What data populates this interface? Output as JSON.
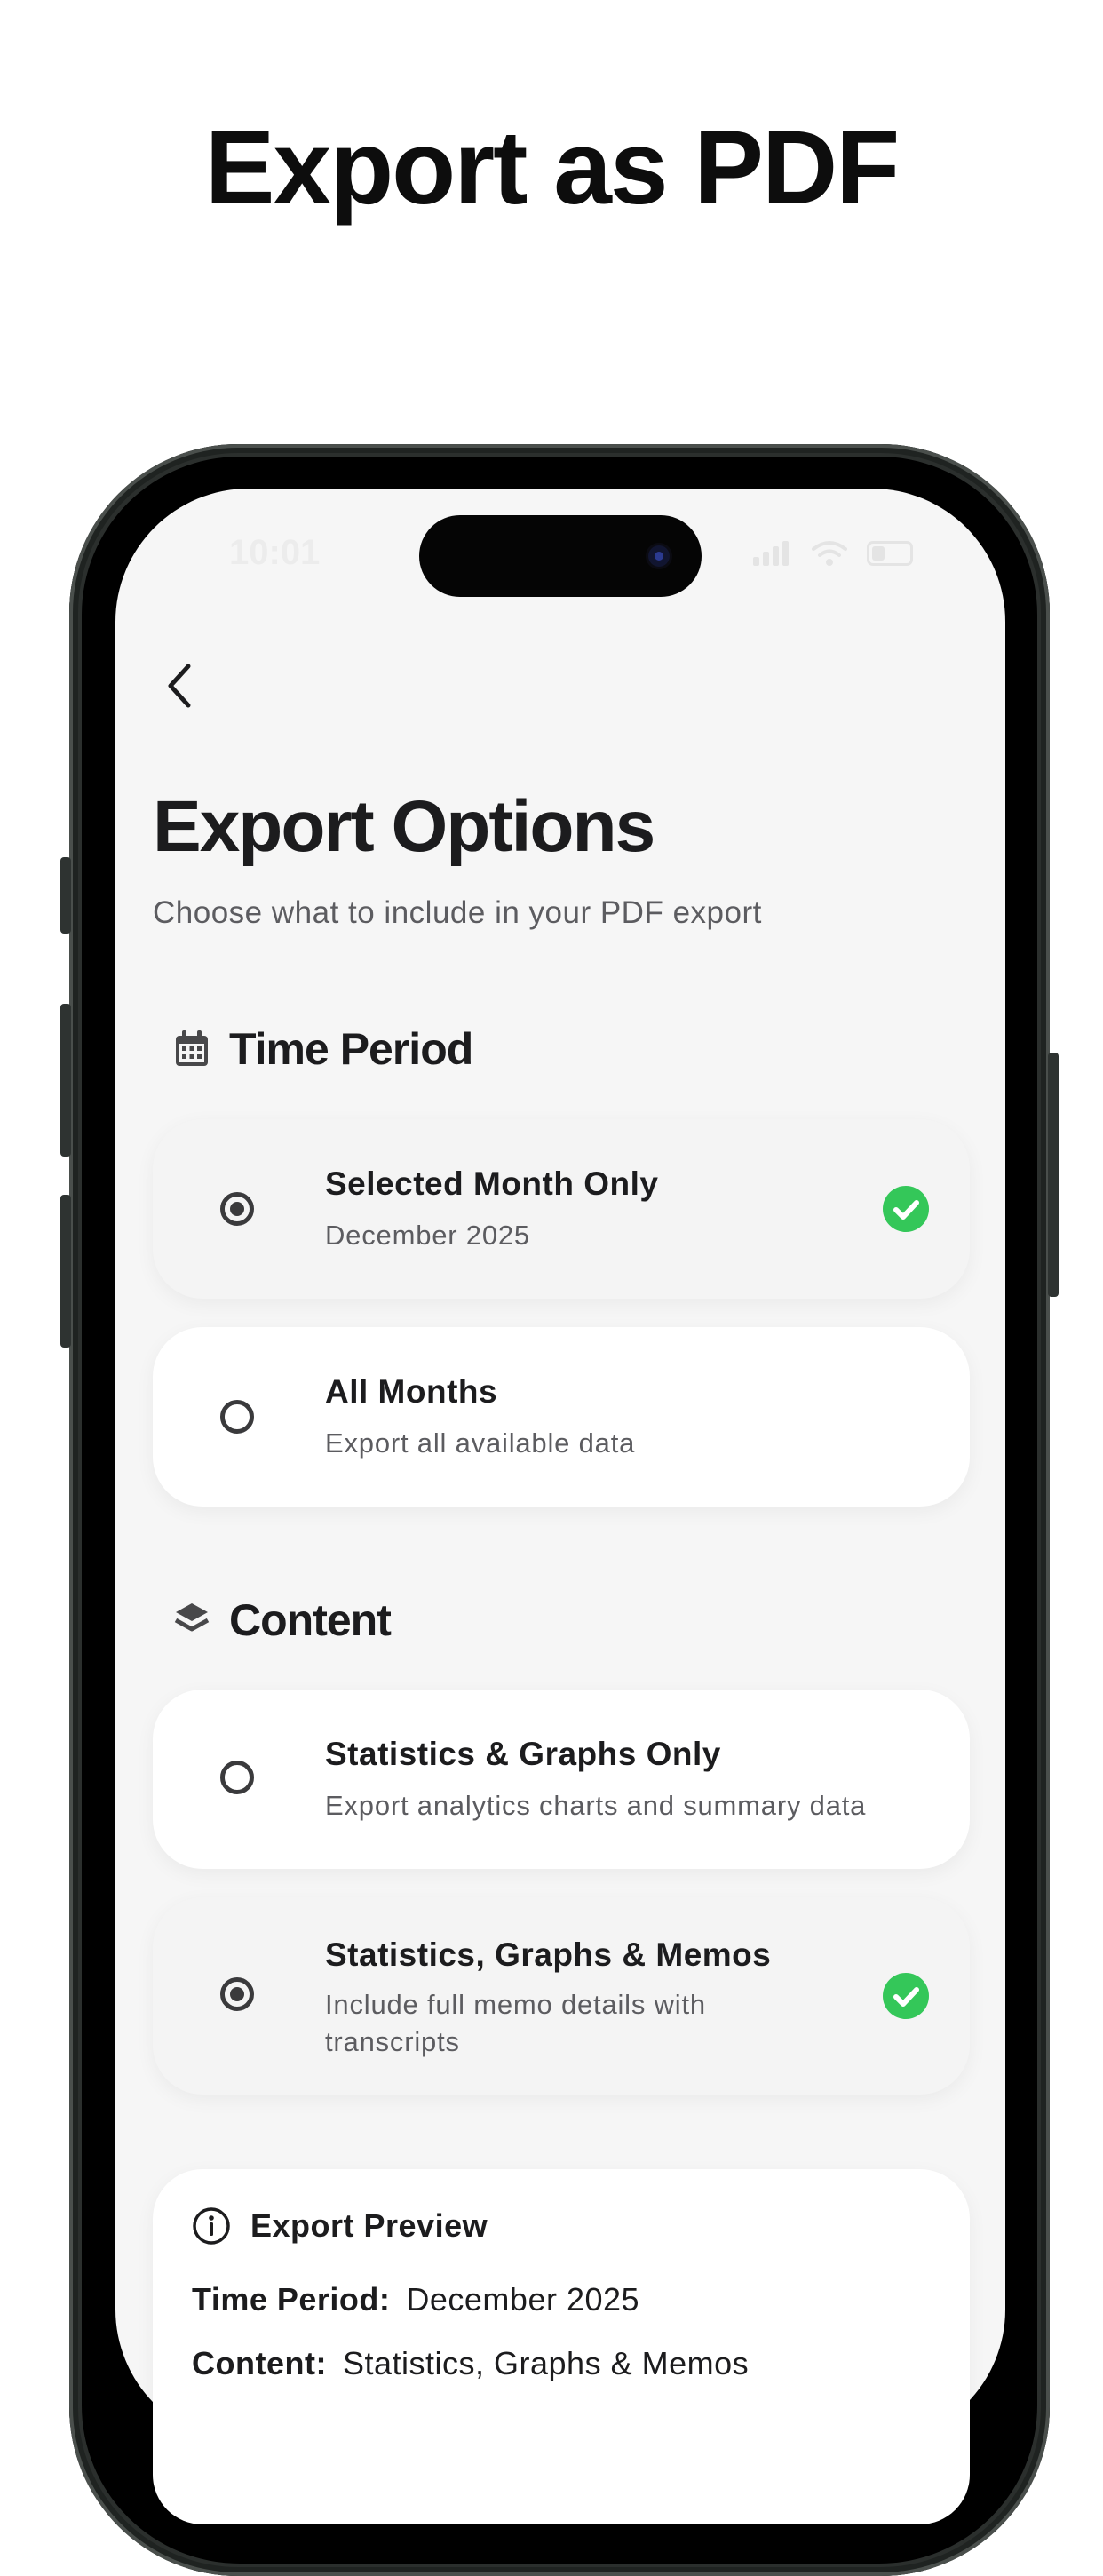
{
  "headline": "Export as PDF",
  "status_bar": {
    "time": "10:01"
  },
  "screen": {
    "title": "Export Options",
    "subtitle": "Choose what to include in your PDF export",
    "time_period": {
      "label": "Time Period",
      "icon": "calendar-icon",
      "options": [
        {
          "title": "Selected Month Only",
          "description": "December 2025",
          "selected": true
        },
        {
          "title": "All Months",
          "description": "Export all available data",
          "selected": false
        }
      ]
    },
    "content": {
      "label": "Content",
      "icon": "layers-icon",
      "options": [
        {
          "title": "Statistics & Graphs Only",
          "description": "Export analytics charts and summary data",
          "selected": false
        },
        {
          "title": "Statistics, Graphs & Memos",
          "description": "Include full memo details with transcripts",
          "selected": true
        }
      ]
    },
    "preview": {
      "label": "Export Preview",
      "icon": "info-icon",
      "time_period_key": "Time Period:",
      "time_period_value": "December 2025",
      "content_key": "Content:",
      "content_value": "Statistics, Graphs & Memos"
    }
  },
  "colors": {
    "accent_check": "#34c759",
    "screen_bg": "#f6f6f6"
  }
}
